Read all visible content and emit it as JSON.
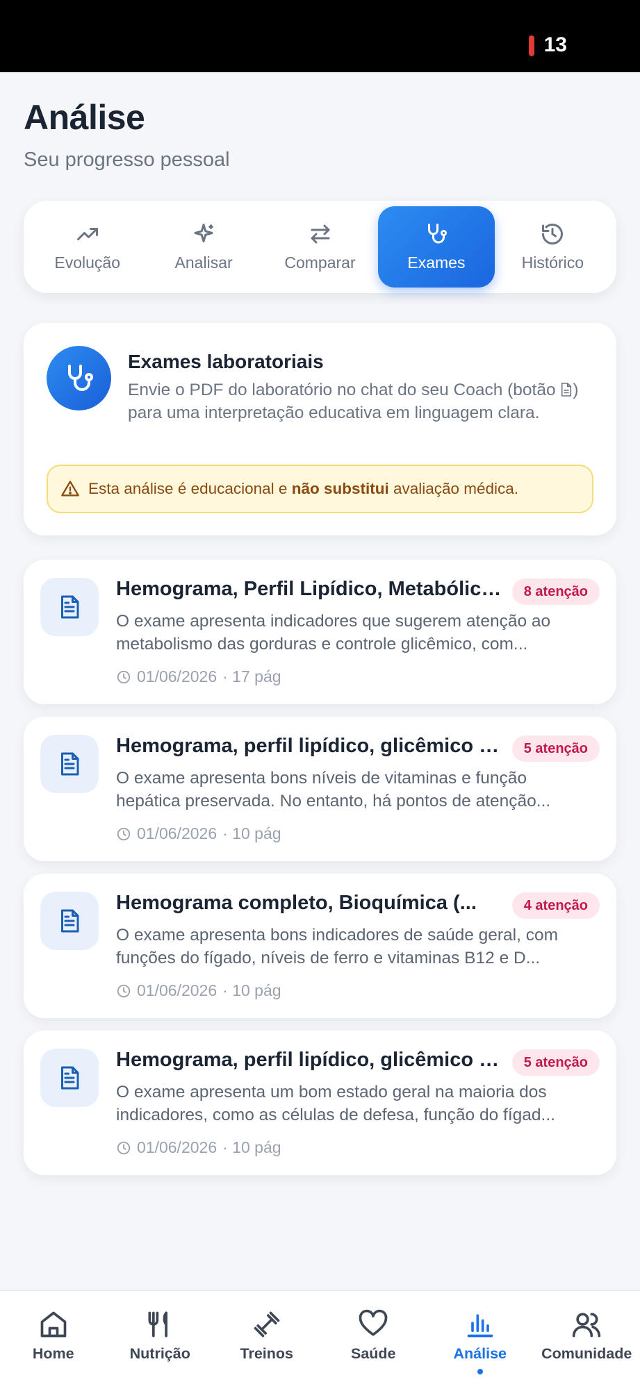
{
  "status_bar": {
    "time": "13"
  },
  "header": {
    "title": "Análise",
    "subtitle": "Seu progresso pessoal"
  },
  "tabs": [
    {
      "label": "Evolução",
      "icon": "trend-up-icon",
      "active": false
    },
    {
      "label": "Analisar",
      "icon": "sparkles-icon",
      "active": false
    },
    {
      "label": "Comparar",
      "icon": "arrows-swap-icon",
      "active": false
    },
    {
      "label": "Exames",
      "icon": "stethoscope-icon",
      "active": true
    },
    {
      "label": "Histórico",
      "icon": "history-icon",
      "active": false
    }
  ],
  "info_card": {
    "title": "Exames laboratoriais",
    "body_before_icon": "Envie o PDF do laboratório no chat do seu Coach (botão ",
    "body_after_icon": ") para uma interpretação educativa em linguagem clara.",
    "warning_before": "Esta análise é educacional e ",
    "warning_bold": "não substitui",
    "warning_after": " avaliação médica."
  },
  "exams": [
    {
      "title": "Hemograma, Perfil Lipídico, Metabólico e Hormonal",
      "badge": "8 atenção",
      "summary_line1": "O exame apresenta indicadores que sugerem atenção ao",
      "summary_line2": "metabolismo das gorduras e controle glicêmico, com...",
      "date": "01/06/2026",
      "pages": "· 17 pág"
    },
    {
      "title": "Hemograma, perfil lipídico, glicêmico e vitaminas",
      "badge": "5 atenção",
      "summary_line1": "O exame apresenta bons níveis de vitaminas e função",
      "summary_line2": "hepática preservada. No entanto, há pontos de atenção...",
      "date": "01/06/2026",
      "pages": "· 10 pág"
    },
    {
      "title": "Hemograma completo, Bioquímica (...",
      "badge": "4 atenção",
      "summary_line1": "O exame apresenta bons indicadores de saúde geral, com",
      "summary_line2": "funções do fígado, níveis de ferro e vitaminas B12 e D...",
      "date": "01/06/2026",
      "pages": "· 10 pág"
    },
    {
      "title": "Hemograma, perfil lipídico, glicêmico e hormonal",
      "badge": "5 atenção",
      "summary_line1": "O exame apresenta um bom estado geral na maioria dos",
      "summary_line2": "indicadores, como as células de defesa, função do fígad...",
      "date": "01/06/2026",
      "pages": "· 10 pág"
    }
  ],
  "bottom_nav": [
    {
      "label": "Home",
      "icon": "home-icon",
      "active": false
    },
    {
      "label": "Nutrição",
      "icon": "utensils-icon",
      "active": false
    },
    {
      "label": "Treinos",
      "icon": "dumbbell-icon",
      "active": false
    },
    {
      "label": "Saúde",
      "icon": "heart-icon",
      "active": false
    },
    {
      "label": "Análise",
      "icon": "bar-chart-icon",
      "active": true
    },
    {
      "label": "Comunidade",
      "icon": "users-icon",
      "active": false
    }
  ],
  "colors": {
    "accent": "#1a73e8",
    "badge_bg": "#fde7ec",
    "badge_text": "#c2184b",
    "warning_bg": "#fff8dc",
    "warning_border": "#f5dc7a"
  }
}
